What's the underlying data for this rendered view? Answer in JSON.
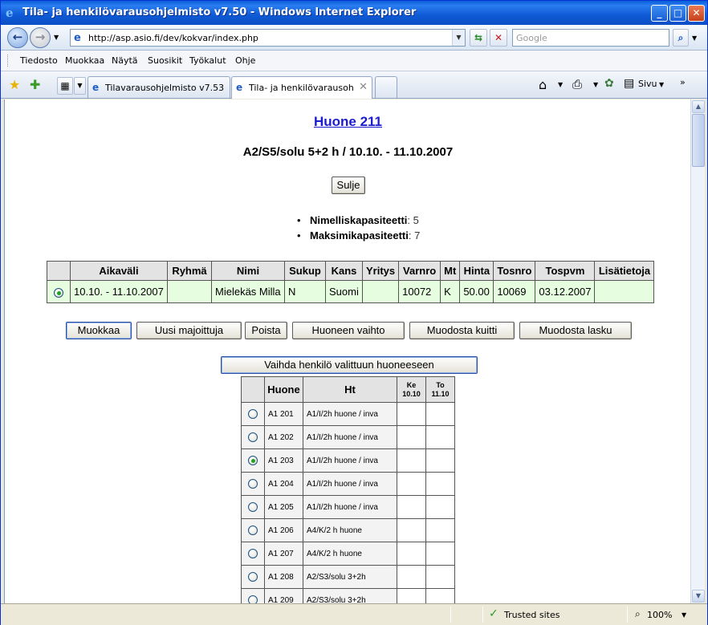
{
  "window": {
    "title": "Tila- ja henkilövarausohjelmisto v7.50 - Windows Internet Explorer"
  },
  "address": {
    "url": "http://asp.asio.fi/dev/kokvar/index.php",
    "search_placeholder": "Google"
  },
  "menu": [
    "Tiedosto",
    "Muokkaa",
    "Näytä",
    "Suosikit",
    "Työkalut",
    "Ohje"
  ],
  "tabs": [
    {
      "label": "Tilavarausohjelmisto v7.53 - ..."
    },
    {
      "label": "Tila- ja henkilövarausohje..."
    }
  ],
  "commandbar": {
    "page_label": "Sivu"
  },
  "page": {
    "room_title": "Huone 211",
    "subtitle": "A2/S5/solu 5+2 h / 10.10. - 11.10.2007",
    "close_button": "Sulje",
    "capacity": [
      {
        "label": "Nimelliskapasiteetti",
        "value": ": 5"
      },
      {
        "label": "Maksimikapasiteetti",
        "value": ": 7"
      }
    ]
  },
  "reservations": {
    "headers": [
      "",
      "Aikaväli",
      "Ryhmä",
      "Nimi",
      "Sukup",
      "Kans",
      "Yritys",
      "Varnro",
      "Mt",
      "Hinta",
      "Tosnro",
      "Tospvm",
      "Lisätietoja"
    ],
    "rows": [
      {
        "selected": true,
        "cells": [
          "10.10. - 11.10.2007",
          "",
          "Mielekäs Milla",
          "N",
          "Suomi",
          "",
          "10072",
          "K",
          "50.00",
          "10069",
          "03.12.2007",
          ""
        ]
      }
    ]
  },
  "actions": [
    "Muokkaa",
    "Uusi majoittuja",
    "Poista",
    "Huoneen vaihto",
    "Muodosta kuitti",
    "Muodosta lasku"
  ],
  "move_button": "Vaihda henkilö valittuun huoneeseen",
  "rooms": {
    "headers": {
      "room": "Huone",
      "type": "Ht",
      "d1_day": "Ke",
      "d1_date": "10.10",
      "d2_day": "To",
      "d2_date": "11.10"
    },
    "rows": [
      {
        "selected": false,
        "room": "A1 201",
        "type": "A1/I/2h huone / inva"
      },
      {
        "selected": false,
        "room": "A1 202",
        "type": "A1/I/2h huone / inva"
      },
      {
        "selected": true,
        "room": "A1 203",
        "type": "A1/I/2h huone / inva"
      },
      {
        "selected": false,
        "room": "A1 204",
        "type": "A1/I/2h huone / inva"
      },
      {
        "selected": false,
        "room": "A1 205",
        "type": "A1/I/2h huone / inva"
      },
      {
        "selected": false,
        "room": "A1 206",
        "type": "A4/K/2 h huone"
      },
      {
        "selected": false,
        "room": "A1 207",
        "type": "A4/K/2 h huone"
      },
      {
        "selected": false,
        "room": "A1 208",
        "type": "A2/S3/solu 3+2h"
      },
      {
        "selected": false,
        "room": "A1 209",
        "type": "A2/S3/solu 3+2h"
      }
    ]
  },
  "status": {
    "zone": "Trusted sites",
    "zoom": "100%"
  }
}
